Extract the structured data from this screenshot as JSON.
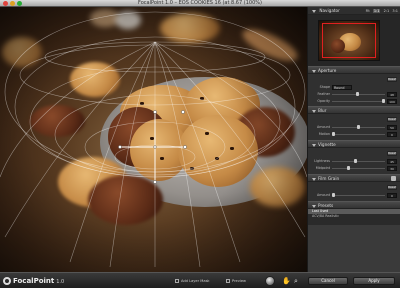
{
  "window": {
    "title": "FocalPoint 1.0 – EOS COOKIES 16 (at 8.67 (100%)"
  },
  "navigator": {
    "title": "Navigator",
    "zooms": [
      "Fit",
      "1:1",
      "2:1",
      "3:1"
    ],
    "active_zoom": "1:1"
  },
  "aperture": {
    "title": "Aperture",
    "reset_label": "Reset",
    "shape_label": "Shape",
    "shape_value": "Round",
    "rows": [
      {
        "label": "Feather",
        "value": "48"
      },
      {
        "label": "Opacity",
        "value": "100"
      }
    ]
  },
  "blur": {
    "title": "Blur",
    "reset_label": "Reset",
    "rows": [
      {
        "label": "Amount",
        "value": "50"
      },
      {
        "label": "Motion",
        "value": "0"
      }
    ]
  },
  "vignette": {
    "title": "Vignette",
    "reset_label": "Reset",
    "rows": [
      {
        "label": "Lightness",
        "value": "45"
      },
      {
        "label": "Midpoint",
        "value": "30"
      }
    ]
  },
  "film_grain": {
    "title": "Film Grain",
    "reset_label": "Reset",
    "rows": [
      {
        "label": "Amount",
        "value": "0"
      }
    ]
  },
  "presets": {
    "title": "Presets",
    "items": [
      "Last Used",
      "ACV/8A Realistic"
    ]
  },
  "bottom": {
    "logo_text": "FocalPoint",
    "version": "1.0",
    "add_layer_mask": "Add Layer Mask",
    "preview": "Preview",
    "cancel": "Cancel",
    "apply": "Apply"
  },
  "colors": {
    "panel_bg": "#3a3a3a",
    "navigator_frame": "#e02020",
    "canvas_bg": "#3a2414"
  }
}
